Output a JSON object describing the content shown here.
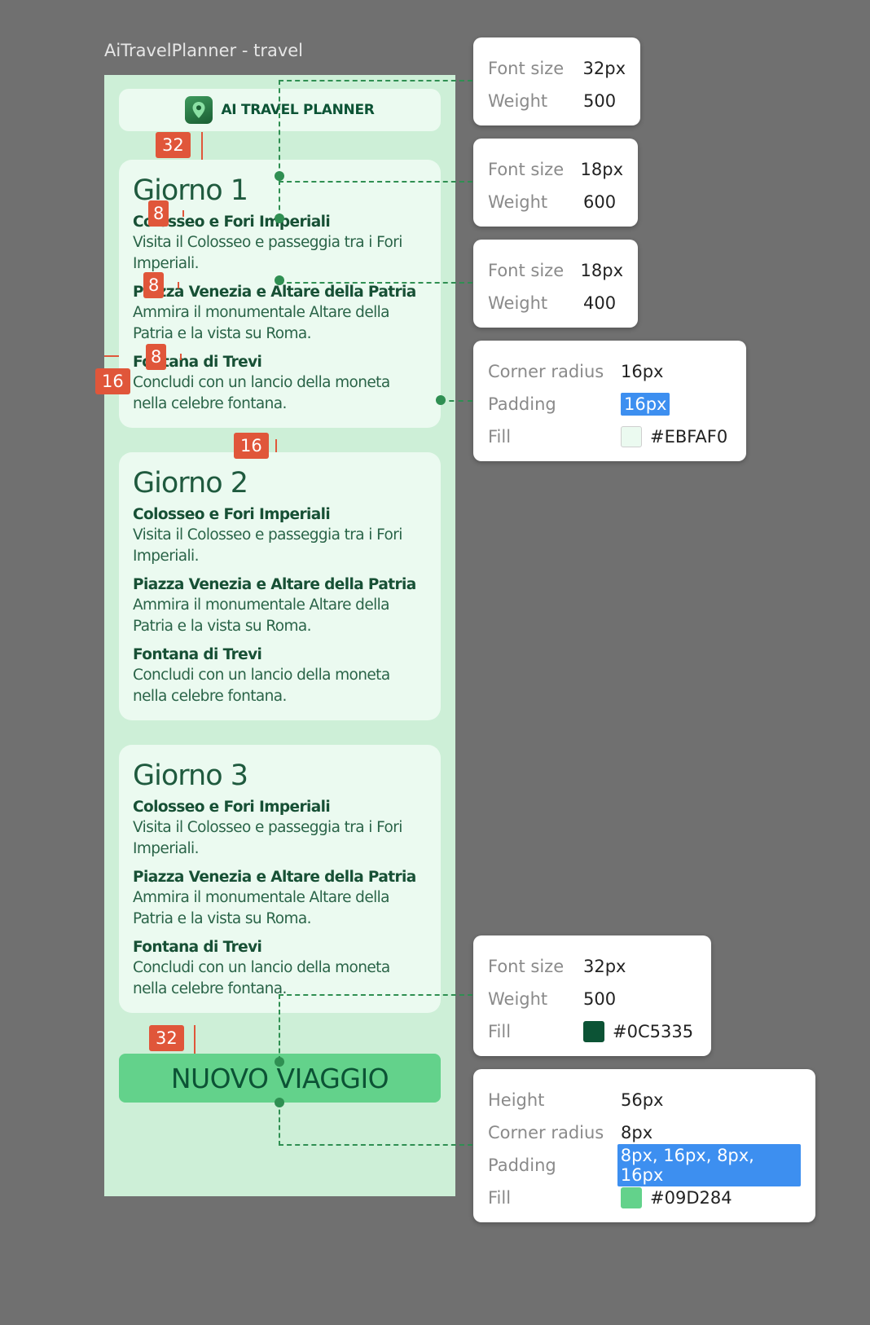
{
  "frame_title": "AiTravelPlanner - travel",
  "header": {
    "title": "AI TRAVEL PLANNER",
    "logo_icon": "map-pin-icon"
  },
  "days": [
    {
      "title": "Giorno 1",
      "activities": [
        {
          "name": "Colosseo e Fori Imperiali",
          "desc": "Visita il Colosseo e passeggia tra i Fori Imperiali."
        },
        {
          "name": "Piazza Venezia e Altare della Patria",
          "desc": "Ammira il monumentale Altare della Patria e la vista su Roma."
        },
        {
          "name": "Fontana di Trevi",
          "desc": "Concludi con un lancio della moneta nella celebre fontana."
        }
      ]
    },
    {
      "title": "Giorno 2",
      "activities": [
        {
          "name": "Colosseo e Fori Imperiali",
          "desc": "Visita il Colosseo e passeggia tra i Fori Imperiali."
        },
        {
          "name": "Piazza Venezia e Altare della Patria",
          "desc": "Ammira il monumentale Altare della Patria e la vista su Roma."
        },
        {
          "name": "Fontana di Trevi",
          "desc": "Concludi con un lancio della moneta nella celebre fontana."
        }
      ]
    },
    {
      "title": "Giorno 3",
      "activities": [
        {
          "name": "Colosseo e Fori Imperiali",
          "desc": "Visita il Colosseo e passeggia tra i Fori Imperiali."
        },
        {
          "name": "Piazza Venezia e Altare della Patria",
          "desc": "Ammira il monumentale Altare della Patria e la vista su Roma."
        },
        {
          "name": "Fontana di Trevi",
          "desc": "Concludi con un lancio della moneta nella celebre fontana."
        }
      ]
    }
  ],
  "button": {
    "label": "NUOVO VIAGGIO"
  },
  "measures": {
    "gap_header": "32",
    "gap_title_act": "8",
    "gap_act1": "8",
    "gap_act2": "8",
    "padding_left": "16",
    "gap_cards": "16",
    "gap_button": "32"
  },
  "specs": {
    "title_font": {
      "k1": "Font size",
      "v1": "32px",
      "k2": "Weight",
      "v2": "500"
    },
    "act_name_font": {
      "k1": "Font size",
      "v1": "18px",
      "k2": "Weight",
      "v2": "600"
    },
    "act_desc_font": {
      "k1": "Font size",
      "v1": "18px",
      "k2": "Weight",
      "v2": "400"
    },
    "card": {
      "k1": "Corner radius",
      "v1": "16px",
      "k2": "Padding",
      "v2": "16px",
      "k3": "Fill",
      "v3": "#EBFAF0",
      "color": "#EBFAF0"
    },
    "button_text": {
      "k1": "Font size",
      "v1": "32px",
      "k2": "Weight",
      "v2": "500",
      "k3": "Fill",
      "v3": "#0C5335",
      "color": "#0C5335"
    },
    "button_box": {
      "k1": "Height",
      "v1": "56px",
      "k2": "Corner radius",
      "v2": "8px",
      "k3": "Padding",
      "v3": "8px, 16px, 8px, 16px",
      "k4": "Fill",
      "v4": "#09D284",
      "color": "#63D28B"
    }
  },
  "colors": {
    "canvas": "#707070",
    "frame": "#CDEFD7",
    "card": "#EBFAF0",
    "text": "#0C5335",
    "button": "#63D28B",
    "badge": "#E0563A",
    "guide": "#2f8f52"
  }
}
